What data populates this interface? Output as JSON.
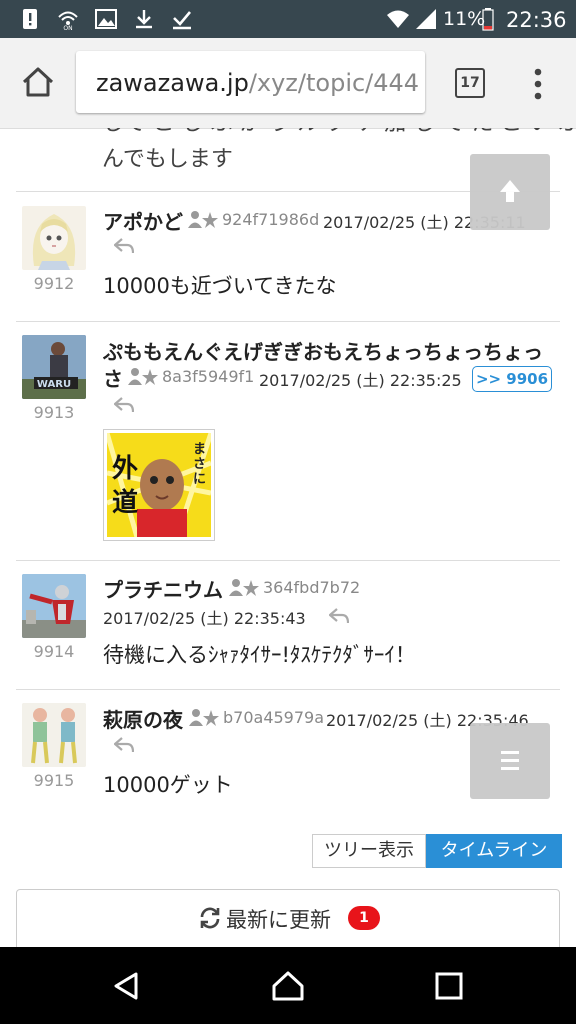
{
  "status_bar": {
    "battery_percent": "11%",
    "time": "22:36",
    "icons": [
      "alert-icon",
      "wifi-calling-icon",
      "image-icon",
      "download-icon",
      "check-icon",
      "wifi-icon",
      "signal-icon",
      "battery-icon"
    ]
  },
  "browser": {
    "url_host": "zawazawa.jp",
    "url_path": "/xyz/topic/444",
    "tab_count": "17"
  },
  "thread": {
    "cut_text": "して こ し ふ か う ル ク ケ 加 し て た こ い ふ\nんでもします",
    "posts": [
      {
        "number": "9912",
        "name": "アポかど",
        "uid": "924f71986d",
        "date": "2017/02/25 (土) 22:35:11",
        "body": "10000も近づいてきたな"
      },
      {
        "number": "9913",
        "name_line1": "ぷももえんぐえげぎぎおもえちょっちょっちょっ",
        "name_line2": "さ",
        "uid": "8a3f5949f1",
        "date": "2017/02/25 (土) 22:35:25",
        "anchor": ">> 9906",
        "sticker_vertical": "まさに",
        "sticker_big": "外道"
      },
      {
        "number": "9914",
        "name": "プラチニウム",
        "uid": "364fbd7b72",
        "date": "2017/02/25 (土) 22:35:43",
        "body": "待機に入るｼｬｧﾀｲｻｰ!ﾀｽｹﾃｸﾀﾞｻｰｲ！"
      },
      {
        "number": "9915",
        "name": "萩原の夜",
        "uid": "b70a45979a",
        "date": "2017/02/25 (土) 22:35:46",
        "body": "10000ゲット"
      }
    ]
  },
  "view_toggle": {
    "tree": "ツリー表示",
    "timeline": "タイムライン"
  },
  "refresh": {
    "label": "最新に更新",
    "badge": "1"
  },
  "colors": {
    "accent": "#2a8fd6",
    "status_bar": "#37474f",
    "badge": "#e8141a"
  }
}
